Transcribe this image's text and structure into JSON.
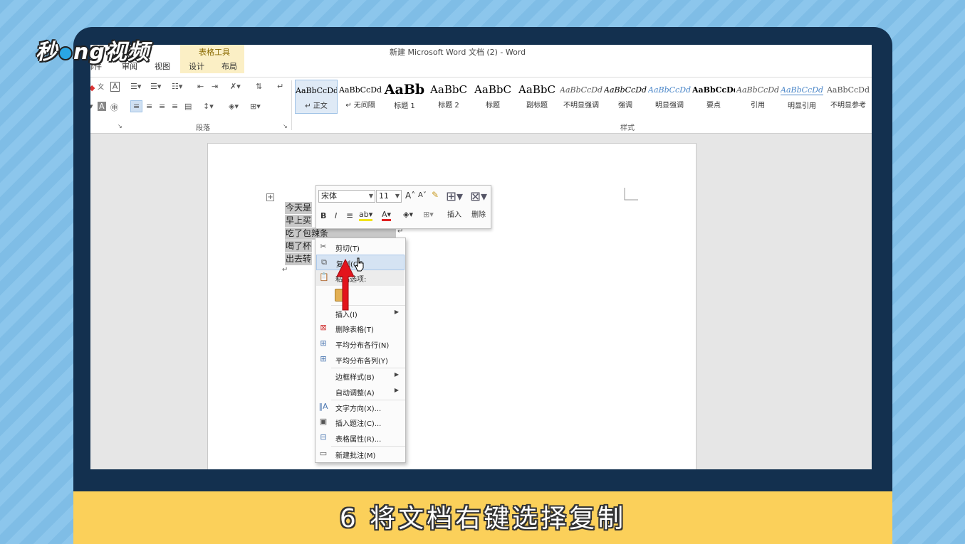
{
  "watermark": {
    "logo_text": "秒dong视频"
  },
  "word": {
    "title": "新建 Microsoft Word 文档 (2) - Word",
    "context_group": "表格工具",
    "tabs": [
      "邮件",
      "审阅",
      "视图",
      "设计",
      "布局"
    ],
    "ribbon_groups": {
      "paragraph": "段落",
      "styles": "样式"
    },
    "styles": [
      {
        "preview": "AaBbCcDd",
        "name": "↵ 正文"
      },
      {
        "preview": "AaBbCcDd",
        "name": "↵ 无间隔"
      },
      {
        "preview": "AaBb",
        "name": "标题 1"
      },
      {
        "preview": "AaBbC",
        "name": "标题 2"
      },
      {
        "preview": "AaBbC",
        "name": "标题"
      },
      {
        "preview": "AaBbC",
        "name": "副标题"
      },
      {
        "preview": "AaBbCcDd",
        "name": "不明显强调"
      },
      {
        "preview": "AaBbCcDd",
        "name": "强调"
      },
      {
        "preview": "AaBbCcDd",
        "name": "明显强调"
      },
      {
        "preview": "AaBbCcDd",
        "name": "要点"
      },
      {
        "preview": "AaBbCcDd",
        "name": "引用"
      },
      {
        "preview": "AaBbCcDd",
        "name": "明显引用"
      },
      {
        "preview": "AaBbCcDd",
        "name": "不明显参考"
      }
    ]
  },
  "document": {
    "lines": [
      "今天是",
      "早上买",
      "吃了包辣条",
      "喝了杯",
      "出去转"
    ]
  },
  "mini_toolbar": {
    "font": "宋体",
    "size": "11",
    "insert_label": "插入",
    "delete_label": "删除"
  },
  "context_menu": {
    "cut": "剪切(T)",
    "copy": "复制(C)",
    "paste_options": "粘贴选项:",
    "insert": "插入(I)",
    "delete_table": "删除表格(T)",
    "distribute_rows": "平均分布各行(N)",
    "distribute_cols": "平均分布各列(Y)",
    "border_styles": "边框样式(B)",
    "autofit": "自动调整(A)",
    "text_direction": "文字方向(X)...",
    "insert_caption": "插入题注(C)...",
    "table_properties": "表格属性(R)...",
    "new_comment": "新建批注(M)"
  },
  "caption": "6 将文档右键选择复制"
}
